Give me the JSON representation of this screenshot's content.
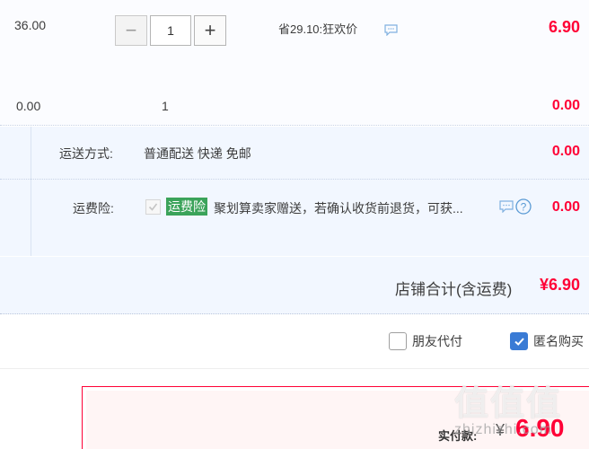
{
  "item_row": {
    "unit_price": "36.00",
    "quantity": "1",
    "minus_label": "−",
    "plus_label": "+",
    "saving_text": "省29.10:狂欢价",
    "subtotal": "6.90"
  },
  "gift_row": {
    "unit_price": "0.00",
    "quantity": "1",
    "subtotal": "0.00"
  },
  "shipping": {
    "label": "运送方式:",
    "method": "普通配送 快递 免邮",
    "price": "0.00"
  },
  "insurance": {
    "label": "运费险:",
    "badge": "运费险",
    "description": "聚划算卖家赠送，若确认收货前退货，可获...",
    "price": "0.00"
  },
  "store_total": {
    "label": "店铺合计(含运费)",
    "value": "¥6.90"
  },
  "options": {
    "friend_pay": {
      "label": "朋友代付",
      "checked": false
    },
    "anonymous": {
      "label": "匿名购买",
      "checked": true
    }
  },
  "payment": {
    "label": "实付款:",
    "currency": "¥",
    "amount": "6.90"
  },
  "watermark": {
    "logo": "值值值",
    "url": "zhizhizhi.com"
  },
  "colors": {
    "price_red": "#ff0036",
    "insurance_green": "#3ba35a",
    "checkbox_blue": "#3a7bd5"
  }
}
